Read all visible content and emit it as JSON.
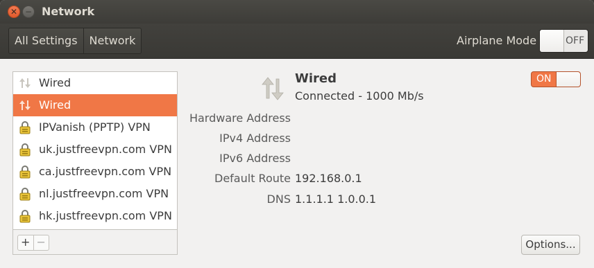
{
  "window": {
    "title": "Network"
  },
  "toolbar": {
    "breadcrumbs": [
      "All Settings",
      "Network"
    ],
    "airplane_label": "Airplane Mode",
    "airplane_state": "OFF"
  },
  "devices": [
    {
      "label": "Wired",
      "icon": "wired-arrows-icon",
      "selected": false
    },
    {
      "label": "Wired",
      "icon": "wired-arrows-icon",
      "selected": true
    },
    {
      "label": "IPVanish (PPTP) VPN",
      "icon": "vpn-lock-icon",
      "selected": false
    },
    {
      "label": "uk.justfreevpn.com VPN",
      "icon": "vpn-lock-icon",
      "selected": false
    },
    {
      "label": "ca.justfreevpn.com VPN",
      "icon": "vpn-lock-icon",
      "selected": false
    },
    {
      "label": "nl.justfreevpn.com VPN",
      "icon": "vpn-lock-icon",
      "selected": false
    },
    {
      "label": "hk.justfreevpn.com VPN",
      "icon": "vpn-lock-icon",
      "selected": false
    }
  ],
  "list_tools": {
    "add": "+",
    "remove": "−"
  },
  "detail": {
    "name": "Wired",
    "status": "Connected - 1000 Mb/s",
    "toggle_state": "ON",
    "properties": [
      {
        "label": "Hardware Address",
        "value": ""
      },
      {
        "label": "IPv4 Address",
        "value": ""
      },
      {
        "label": "IPv6 Address",
        "value": ""
      },
      {
        "label": "Default Route",
        "value": "192.168.0.1"
      },
      {
        "label": "DNS",
        "value": "1.1.1.1 1.0.0.1"
      }
    ],
    "options_label": "Options..."
  },
  "colors": {
    "accent": "#f07746",
    "titlebar": "#3d3c38",
    "background": "#f2f1f0"
  }
}
